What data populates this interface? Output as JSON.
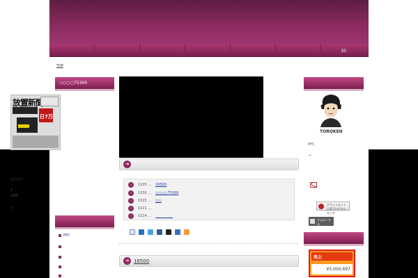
{
  "nav": {
    "count": "20"
  },
  "breadcrumb": {
    "label": "TOP"
  },
  "left_sidebar": {
    "title": "○○○○75300",
    "newspaper": {
      "headline": "放置新聞",
      "amount": "日7万"
    },
    "text1": "○○○○",
    "text2": "1",
    "text3": "※30",
    "link_icon": "⇄",
    "menu": [
      {
        "label": "PPC"
      },
      {
        "label": ""
      },
      {
        "label": ""
      },
      {
        "label": ""
      },
      {
        "label": ""
      }
    ]
  },
  "main": {
    "news_items": [
      {
        "date": "1105 ...",
        "link": "16500"
      },
      {
        "date": "1030 ...",
        "link": "○○○○75300"
      },
      {
        "date": "0325 ...",
        "link": "○○"
      },
      {
        "date": "0221 ...",
        "link": ""
      },
      {
        "date": "0214 ...",
        "link": "__________"
      }
    ],
    "section2_title": "16500"
  },
  "right_sidebar": {
    "username": "TOROKEN",
    "ppc": "PPC",
    "arrow": "→",
    "rank_button": "アフィリエイト 人気ブログランキング",
    "follow_button": "フォローする",
    "sales_title": "売上",
    "sales_value": "¥5,000,697"
  },
  "colors": {
    "brand": "#8a2b5e",
    "sales_bg": "#ff9a1f",
    "sales_head": "#e63b10"
  }
}
